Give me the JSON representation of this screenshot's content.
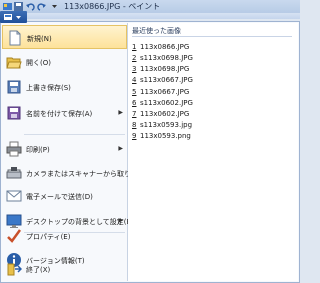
{
  "window": {
    "title": "113x0866.JPG - ペイント"
  },
  "colors": {
    "accent": "#2a5ea8",
    "highlight": "#fde29a"
  },
  "menu_items": [
    {
      "label": "新規(N)",
      "icon": "new-file-icon",
      "submenu": false,
      "selected": true
    },
    {
      "label": "開く(O)",
      "icon": "open-folder-icon",
      "submenu": false
    },
    {
      "label": "上書き保存(S)",
      "icon": "save-icon",
      "submenu": false
    },
    {
      "label": "名前を付けて保存(A)",
      "icon": "save-as-icon",
      "submenu": true
    },
    {
      "label": "印刷(P)",
      "icon": "printer-icon",
      "submenu": true
    },
    {
      "label": "カメラまたはスキャナーから取り込み(M)",
      "icon": "scanner-icon",
      "submenu": false
    },
    {
      "label": "電子メールで送信(D)",
      "icon": "email-icon",
      "submenu": false
    },
    {
      "label": "デスクトップの背景として設定(B)",
      "icon": "desktop-background-icon",
      "submenu": true
    },
    {
      "label": "プロパティ(E)",
      "icon": "properties-check-icon",
      "submenu": false
    },
    {
      "label": "バージョン情報(T)",
      "icon": "info-icon",
      "submenu": false
    },
    {
      "label": "終了(X)",
      "icon": "exit-icon",
      "submenu": false
    }
  ],
  "recent": {
    "title": "最近使った画像",
    "items": [
      {
        "num": "1",
        "name": "113x0866.JPG"
      },
      {
        "num": "2",
        "name": "s113x0698.JPG"
      },
      {
        "num": "3",
        "name": "113x0698.JPG"
      },
      {
        "num": "4",
        "name": "s113x0667.JPG"
      },
      {
        "num": "5",
        "name": "113x0667.JPG"
      },
      {
        "num": "6",
        "name": "s113x0602.JPG"
      },
      {
        "num": "7",
        "name": "113x0602.JPG"
      },
      {
        "num": "8",
        "name": "s113x0593.jpg"
      },
      {
        "num": "9",
        "name": "113x0593.png"
      }
    ]
  }
}
